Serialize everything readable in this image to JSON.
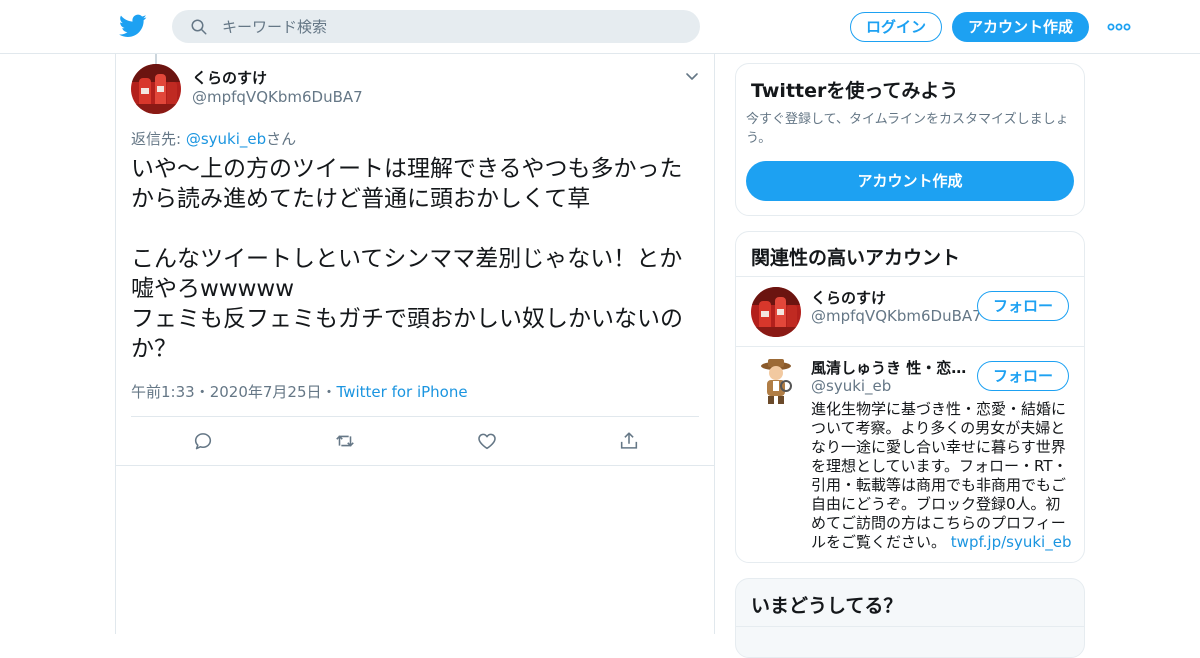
{
  "header": {
    "search_placeholder": "キーワード検索",
    "login_label": "ログイン",
    "signup_label": "アカウント作成",
    "brand_color": "#1da1f2"
  },
  "tweet": {
    "author_name": "くらのすけ",
    "author_handle": "@mpfqVQKbm6DuBA7",
    "reply_prefix": "返信先: ",
    "reply_mention": "@syuki_eb",
    "reply_suffix": "さん",
    "text": "いや〜上の方のツイートは理解できるやつも多かったから読み進めてたけど普通に頭おかしくて草\n\nこんなツイートしといてシンママ差別じゃない！とか嘘やろwwwww\nフェミも反フェミもガチで頭おかしい奴しかいないのか？",
    "time": "午前1:33",
    "date": "2020年7月25日",
    "source": "Twitter for iPhone",
    "separator": "・",
    "actions": [
      "reply-icon",
      "retweet-icon",
      "like-icon",
      "share-icon"
    ]
  },
  "signup_card": {
    "title": "Twitterを使ってみよう",
    "description": "今すぐ登録して、タイムラインをカスタマイズしましょう。",
    "button_label": "アカウント作成"
  },
  "related": {
    "title": "関連性の高いアカウント",
    "accounts": [
      {
        "name": "くらのすけ",
        "handle": "@mpfqVQKbm6DuBA7",
        "follow_label": "フォロー"
      },
      {
        "name": "風清しゅうき 性・恋…",
        "handle": "@syuki_eb",
        "follow_label": "フォロー",
        "bio": "進化生物学に基づき性・恋愛・結婚について考察。より多くの男女が夫婦となり一途に愛し合い幸せに暮らす世界を理想としています。フォロー・RT・引用・転載等は商用でも非商用でもご自由にどうぞ。ブロック登録0人。初めてご訪問の方はこちらのプロフィールをご覧ください。",
        "bio_link": "twpf.jp/syuki_eb"
      }
    ]
  },
  "trends": {
    "title": "いまどうしてる？"
  }
}
